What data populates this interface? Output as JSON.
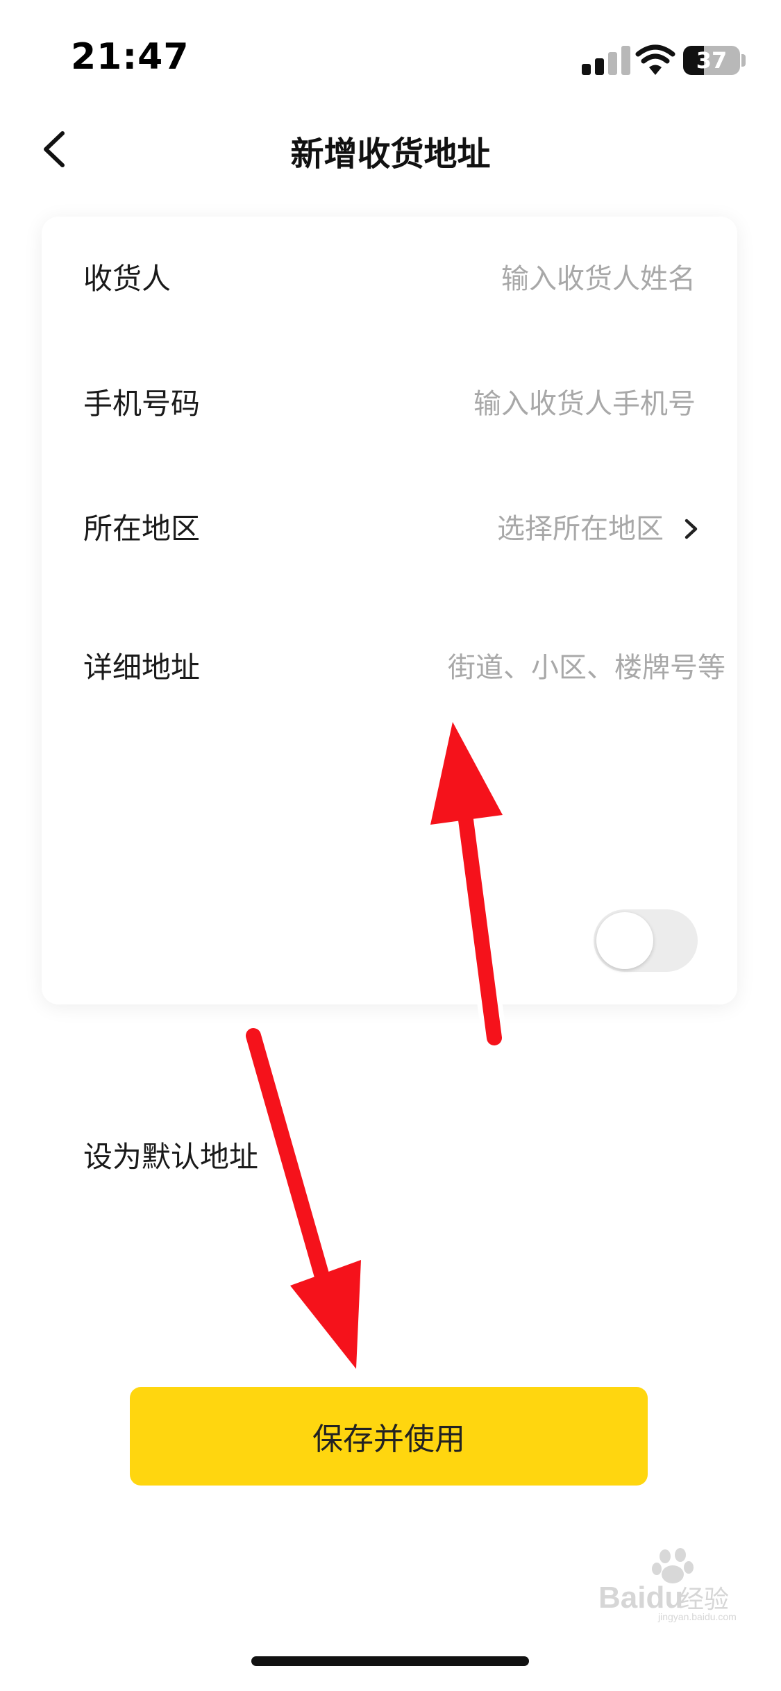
{
  "status_bar": {
    "time": "21:47",
    "battery_level": "37",
    "battery_fraction": 0.37
  },
  "header": {
    "back_icon": "chevron-left-icon",
    "title": "新增收货地址"
  },
  "form": {
    "recipient": {
      "label": "收货人",
      "placeholder": "输入收货人姓名",
      "value": ""
    },
    "phone": {
      "label": "手机号码",
      "placeholder": "输入收货人手机号",
      "value": ""
    },
    "region": {
      "label": "所在地区",
      "placeholder": "选择所在地区",
      "icon": "chevron-right-icon"
    },
    "address": {
      "label": "详细地址",
      "placeholder": "街道、小区、楼牌号等",
      "value": ""
    },
    "default_address": {
      "label": "设为默认地址",
      "enabled": false
    }
  },
  "actions": {
    "save_label": "保存并使用"
  },
  "colors": {
    "accent": "#FFD60F",
    "annotation_arrow": "#F5121B",
    "placeholder": "#A8A8A8"
  },
  "watermark": {
    "brand": "Baidu",
    "text": "经验",
    "site": "jingyan.baidu.com"
  }
}
